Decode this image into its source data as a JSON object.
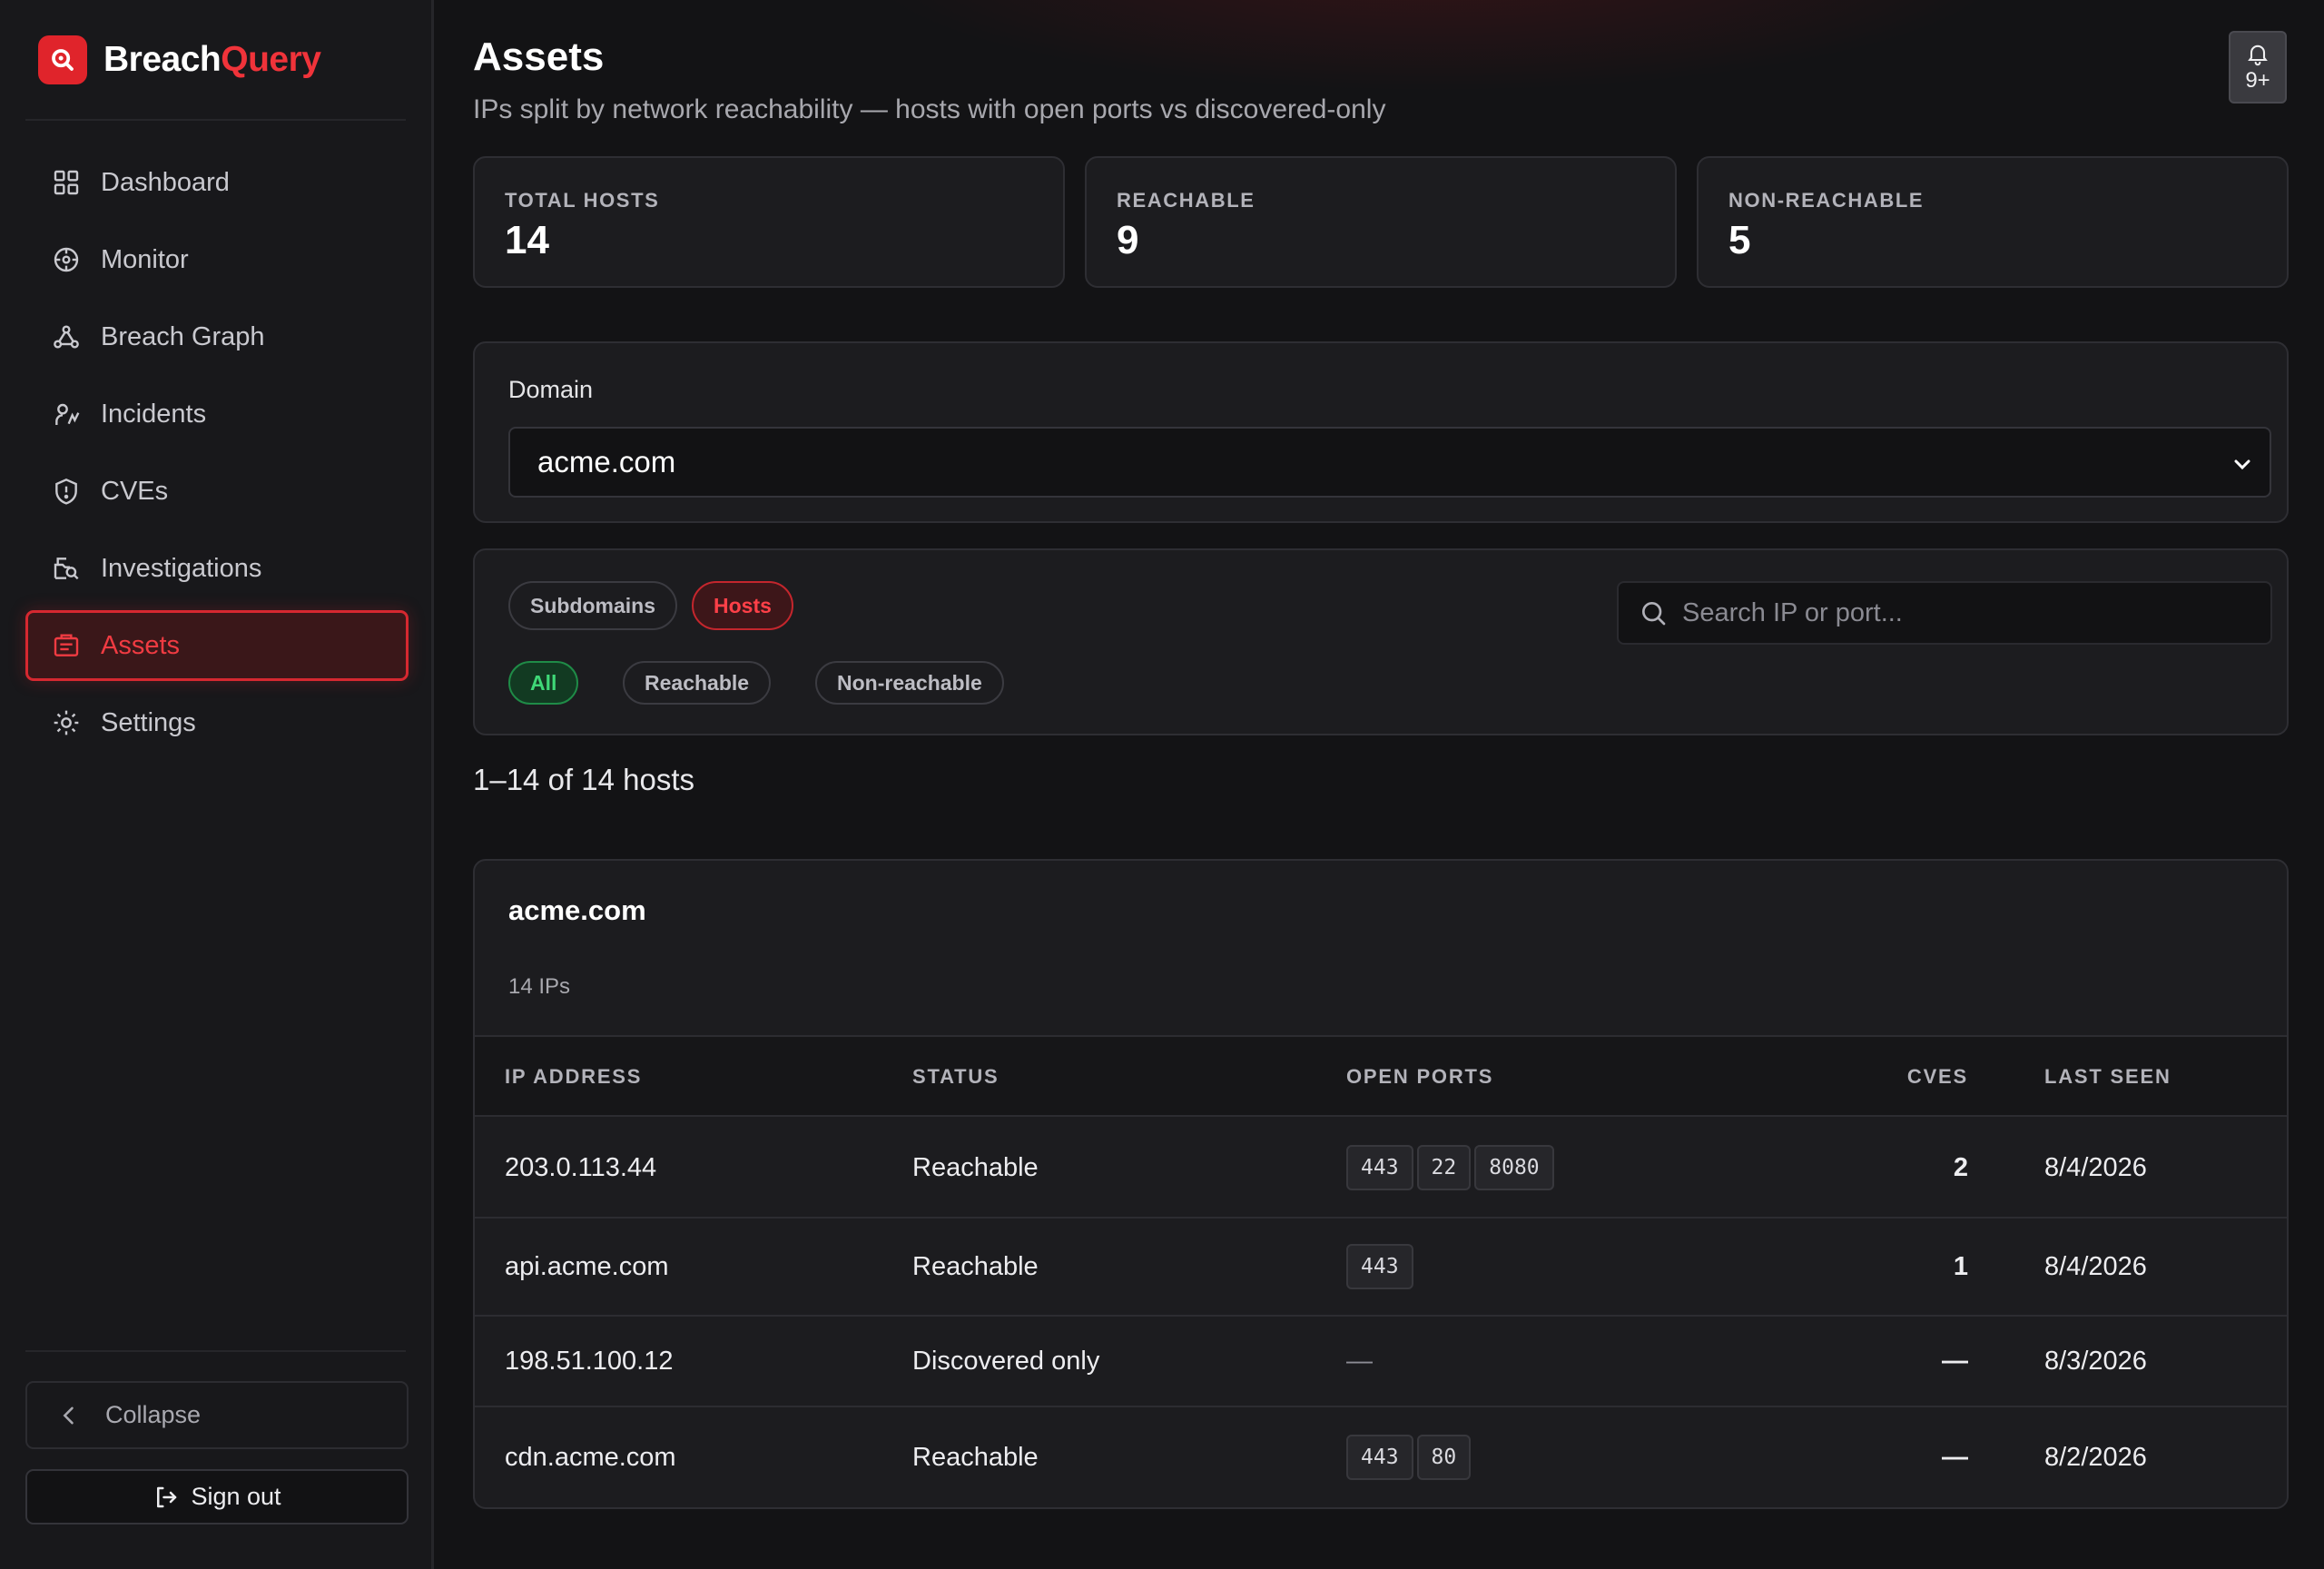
{
  "brand": {
    "name_part1": "Breach",
    "name_part2": "Query"
  },
  "sidebar": {
    "items": [
      {
        "label": "Dashboard",
        "icon": "grid-icon"
      },
      {
        "label": "Monitor",
        "icon": "crosshair-icon"
      },
      {
        "label": "Breach Graph",
        "icon": "network-icon"
      },
      {
        "label": "Incidents",
        "icon": "incident-icon"
      },
      {
        "label": "CVEs",
        "icon": "shield-alert-icon"
      },
      {
        "label": "Investigations",
        "icon": "search-folder-icon"
      },
      {
        "label": "Assets",
        "icon": "asset-box-icon",
        "active": true
      },
      {
        "label": "Settings",
        "icon": "gear-icon"
      }
    ],
    "collapse_label": "Collapse",
    "signout_label": "Sign out"
  },
  "header": {
    "title": "Assets",
    "subtitle": "IPs split by network reachability — hosts with open ports vs discovered-only",
    "notifications": "9+"
  },
  "stats": [
    {
      "label": "TOTAL HOSTS",
      "value": "14"
    },
    {
      "label": "REACHABLE",
      "value": "9"
    },
    {
      "label": "NON-REACHABLE",
      "value": "5"
    }
  ],
  "domain_filter": {
    "label": "Domain",
    "selected": "acme.com"
  },
  "filters": {
    "view_tabs": [
      "Subdomains",
      "Hosts"
    ],
    "active_view": "Hosts",
    "status_tabs": [
      "All",
      "Reachable",
      "Non-reachable"
    ],
    "active_status": "All",
    "search_placeholder": "Search IP or port..."
  },
  "results_summary": "1–14 of 14 hosts",
  "table": {
    "domain": "acme.com",
    "count_label": "14 IPs",
    "columns": [
      "IP ADDRESS",
      "STATUS",
      "OPEN PORTS",
      "CVES",
      "LAST SEEN"
    ],
    "rows": [
      {
        "ip": "203.0.113.44",
        "status": "Reachable",
        "ports": [
          "443",
          "22",
          "8080"
        ],
        "ports_empty": "",
        "cves": "2",
        "last_seen": "8/4/2026"
      },
      {
        "ip": "api.acme.com",
        "status": "Reachable",
        "ports": [
          "443"
        ],
        "ports_empty": "",
        "cves": "1",
        "last_seen": "8/4/2026"
      },
      {
        "ip": "198.51.100.12",
        "status": "Discovered only",
        "ports": [],
        "ports_empty": "—",
        "cves": "—",
        "last_seen": "8/3/2026"
      },
      {
        "ip": "cdn.acme.com",
        "status": "Reachable",
        "ports": [
          "443",
          "80"
        ],
        "ports_empty": "",
        "cves": "—",
        "last_seen": "8/2/2026"
      }
    ]
  },
  "colors": {
    "accent": "#e0242b",
    "success": "#3fd877",
    "background": "#131315",
    "surface": "#1c1c1f"
  }
}
